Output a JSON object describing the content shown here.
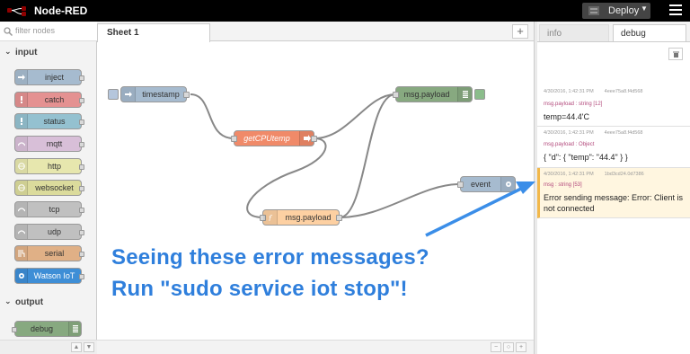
{
  "app": {
    "title": "Node-RED"
  },
  "header": {
    "deploy_label": "Deploy"
  },
  "palette": {
    "filter_placeholder": "filter nodes",
    "categories": [
      {
        "label": "input",
        "nodes": [
          {
            "label": "inject",
            "color": "#a6bbcf",
            "icon": "arrow-icon"
          },
          {
            "label": "catch",
            "color": "#e49191",
            "icon": "exclamation-icon"
          },
          {
            "label": "status",
            "color": "#94c1d0",
            "icon": "exclamation-icon"
          },
          {
            "label": "mqtt",
            "color": "#d8bfd8",
            "icon": "bridge-icon"
          },
          {
            "label": "http",
            "color": "#e7e7ae",
            "icon": "globe-icon"
          },
          {
            "label": "websocket",
            "color": "#dbdb9c",
            "icon": "globe-icon"
          },
          {
            "label": "tcp",
            "color": "#c0c0c0",
            "icon": "bridge-icon"
          },
          {
            "label": "udp",
            "color": "#c0c0c0",
            "icon": "bridge-icon"
          },
          {
            "label": "serial",
            "color": "#e0b086",
            "icon": "serial-icon"
          },
          {
            "label": "Watson IoT",
            "color": "#3e8ed6",
            "icon": "watson-icon"
          }
        ]
      },
      {
        "label": "output",
        "nodes": [
          {
            "label": "debug",
            "color": "#87a980",
            "icon": "debug-icon"
          }
        ]
      }
    ]
  },
  "workspace": {
    "tab_label": "Sheet 1"
  },
  "flow": {
    "nodes": [
      {
        "id": "timestamp",
        "label": "timestamp",
        "color": "#a6bbcf"
      },
      {
        "id": "getcputemp",
        "label": "getCPUtemp",
        "color": "#f08a69"
      },
      {
        "id": "msgpayload-func",
        "label": "msg.payload",
        "color": "#fdd0a2"
      },
      {
        "id": "msgpayload-debug",
        "label": "msg.payload",
        "color": "#87a980"
      },
      {
        "id": "event",
        "label": "event",
        "color": "#a6bbcf"
      }
    ]
  },
  "sidebar": {
    "tabs": [
      "info",
      "debug"
    ],
    "active_tab": "debug",
    "messages": [
      {
        "time": "4/30/2016, 1:42:31 PM",
        "id": "4eee75a8.f4d568",
        "topic": "msg.payload : string [12]",
        "lines": [
          "temp=44.4'C"
        ]
      },
      {
        "time": "4/30/2016, 1:42:31 PM",
        "id": "4eee75a8.f4d568",
        "topic": "msg.payload : Object",
        "lines": [
          "{ \"d\": { \"temp\": \"44.4\" } }"
        ]
      },
      {
        "time": "4/30/2016, 1:42:31 PM",
        "id": "1bd3cd24.0d7386",
        "topic": "msg : string [53]",
        "lines": [
          "Error sending message: Error: Client is",
          "not connected"
        ]
      }
    ]
  },
  "annotation": {
    "line1": "Seeing these error messages?",
    "line2": "Run \"sudo service iot stop\"!",
    "color": "#2f7fdc"
  }
}
